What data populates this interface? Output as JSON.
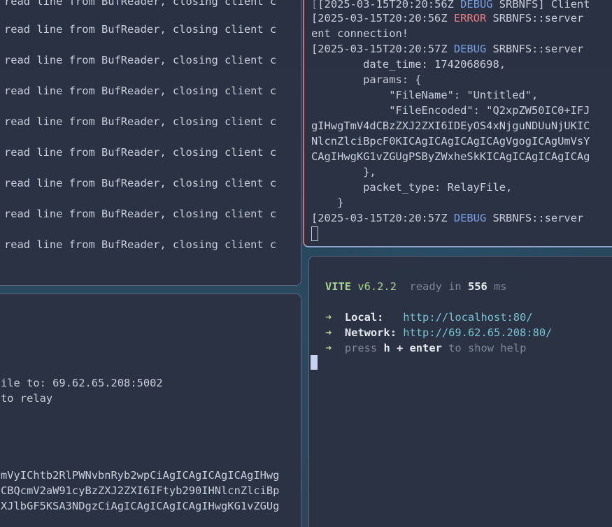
{
  "top_left_pane": {
    "lines": [
      "read line from BufReader, closing client c",
      "read line from BufReader, closing client c",
      "read line from BufReader, closing client c",
      "read line from BufReader, closing client c",
      "read line from BufReader, closing client c",
      "read line from BufReader, closing client c",
      "read line from BufReader, closing client c",
      "read line from BufReader, closing client c",
      "read line from BufReader, closing client c"
    ]
  },
  "bottom_left_pane": {
    "lines": [
      "ile to: 69.62.65.208:5002",
      "to relay",
      "mVyIChtb2RlPWNvbnRyb2wpCiAgICAgICAgICAgIHwg",
      "CBQcmV2aW91cyBzZXJ2ZXI6IFtyb290IHNlcnZlciBp",
      "XJlbGF5KSA3NDgzCiAgICAgICAgICAgIHwgKG1vZGUg"
    ]
  },
  "top_right_pane": {
    "log": [
      {
        "ts": "[2025-03-15T20:20:56Z",
        "level": "DEBUG",
        "module": "SRBNFS] Client"
      },
      {
        "ts": "[2025-03-15T20:20:56Z",
        "level": "ERROR",
        "module": "SRBNFS::server"
      },
      {
        "text": "ent connection!"
      },
      {
        "ts": "[2025-03-15T20:20:57Z",
        "level": "DEBUG",
        "module": "SRBNFS::server"
      },
      {
        "text": "        date_time: 1742068698,"
      },
      {
        "text": "        params: {"
      },
      {
        "text": "            \"FileName\": \"Untitled\","
      },
      {
        "text": "            \"FileEncoded\": \"Q2xpZW50IC0+IFJ"
      },
      {
        "text": "gIHwgTmV4dCBzZXJ2ZXI6IDEyOS4xNjguNDUuNjUKIC"
      },
      {
        "text": "NlcnZlciBpcF0KICAgICAgICAgICAgVgogICAgUmVsY"
      },
      {
        "text": "CAgIHwgKG1vZGUgPSByZWxheSkKICAgICAgICAgICAg"
      },
      {
        "text": "        },"
      },
      {
        "text": "        packet_type: RelayFile,"
      },
      {
        "text": "    }"
      },
      {
        "ts": "[2025-03-15T20:20:57Z",
        "level": "DEBUG",
        "module": "SRBNFS::server"
      }
    ]
  },
  "bottom_right_pane": {
    "vite_name": "VITE",
    "vite_version": "v6.2.2",
    "ready_label": "ready in",
    "ready_ms": "556",
    "ms_label": "ms",
    "arrow": "➜",
    "local_label": "Local:",
    "local_url": "http://localhost:80/",
    "network_label": "Network:",
    "network_url": "http://69.62.65.208:80/",
    "press_label": "press",
    "h_key": "h + enter",
    "help_label": "to show help"
  }
}
